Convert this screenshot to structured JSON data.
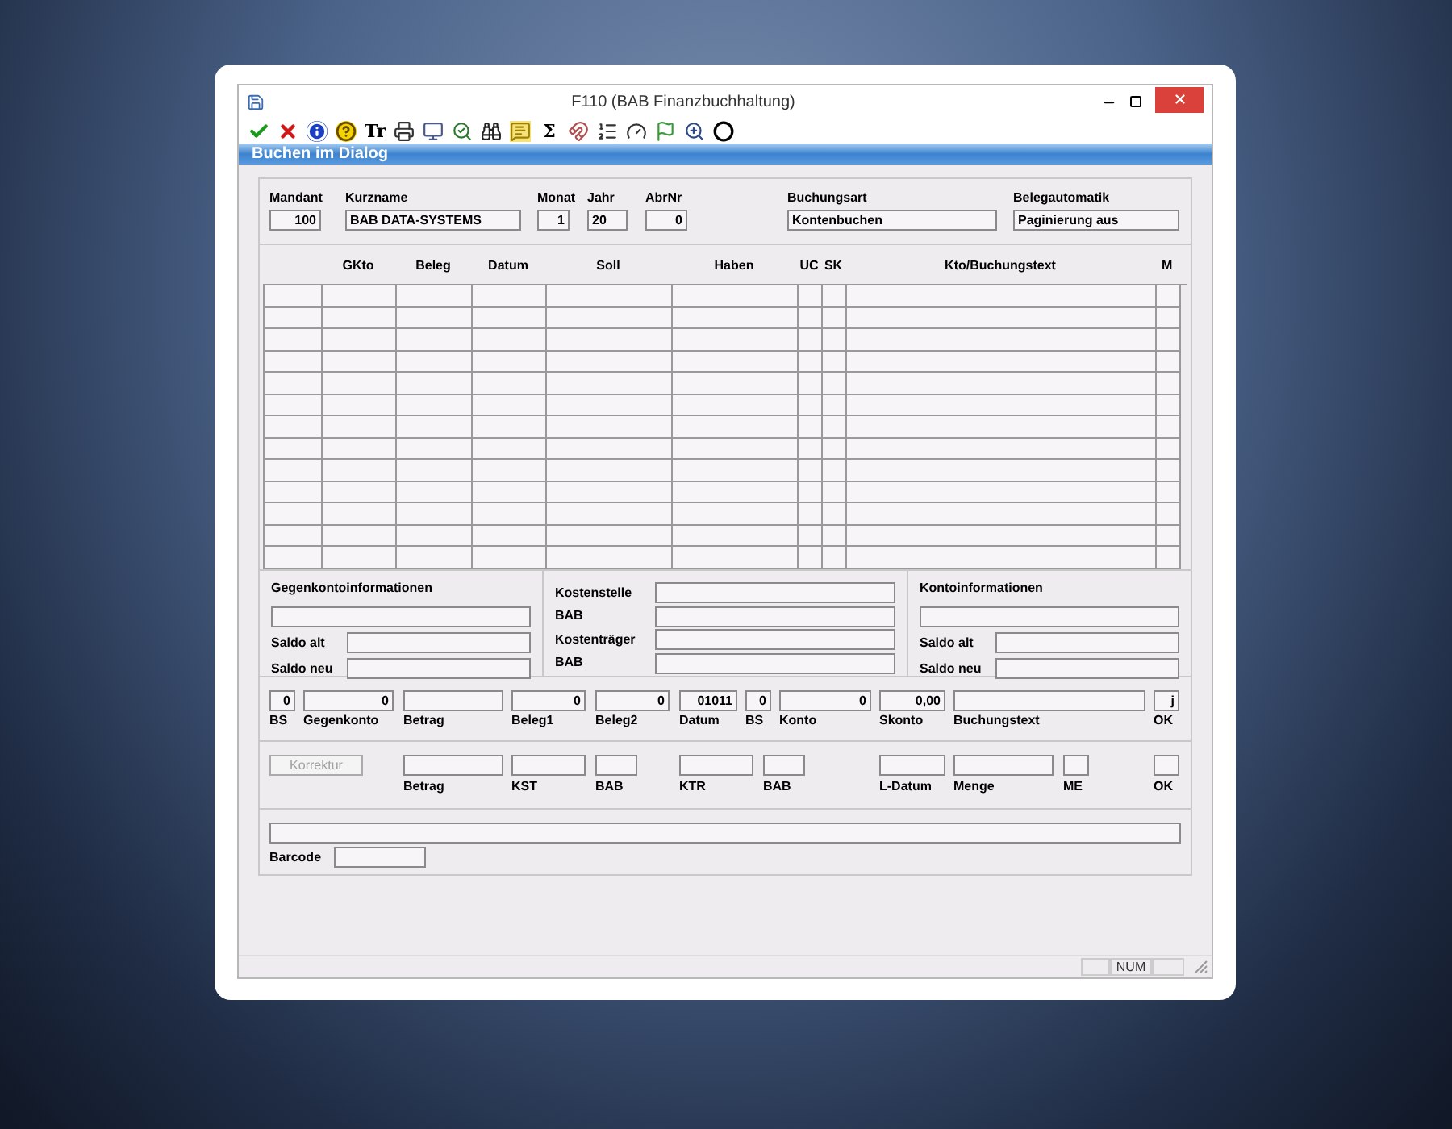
{
  "window": {
    "title": "F110 (BAB Finanzbuchhaltung)"
  },
  "toolbar_texts": [
    "Tr",
    "Σ"
  ],
  "header": {
    "title": "Buchen im Dialog"
  },
  "fields": [
    {
      "label": "Mandant",
      "value": "100",
      "kind": "number"
    },
    {
      "label": "Kurzname",
      "value": "BAB DATA-SYSTEMS",
      "kind": "text"
    },
    {
      "label": "Monat",
      "value": "1",
      "kind": "number"
    },
    {
      "label": "Jahr",
      "value": "20",
      "kind": "text"
    },
    {
      "label": "AbrNr",
      "value": "0",
      "kind": "number"
    },
    {
      "label": "Buchungsart",
      "value": "Kontenbuchen",
      "kind": "text"
    },
    {
      "label": "Belegautomatik",
      "value": "Paginierung aus",
      "kind": "text"
    }
  ],
  "table": {
    "columns": [
      "GKto",
      "Beleg",
      "Datum",
      "Soll",
      "Haben",
      "UC",
      "SK",
      "Kto/Buchungstext",
      "M"
    ]
  },
  "info": {
    "gegenkonto": {
      "title": "Gegenkontoinformationen",
      "saldo_alt": "Saldo alt",
      "saldo_neu": "Saldo neu"
    },
    "kosten": [
      "Kostenstelle",
      "BAB",
      "Kostenträger",
      "BAB"
    ],
    "konto": {
      "title": "Kontoinformationen",
      "saldo_alt": "Saldo alt",
      "saldo_neu": "Saldo neu"
    }
  },
  "entry": [
    {
      "label": "BS",
      "value": "0"
    },
    {
      "label": "Gegenkonto",
      "value": "0"
    },
    {
      "label": "Betrag"
    },
    {
      "label": "Beleg1",
      "value": "0"
    },
    {
      "label": "Beleg2",
      "value": "0"
    },
    {
      "label": "Datum",
      "value": "01011"
    },
    {
      "label": "BS",
      "value": "0"
    },
    {
      "label": "Konto",
      "value": "0"
    },
    {
      "label": "Skonto",
      "value": "0,00"
    },
    {
      "label": "Buchungstext"
    },
    {
      "label": "OK",
      "value": "j"
    }
  ],
  "korrektur": {
    "label": "Korrektur",
    "disabled": true
  },
  "details": [
    "Betrag",
    "KST",
    "BAB",
    "KTR",
    "BAB",
    "L-Datum",
    "Menge",
    "ME",
    "OK"
  ],
  "barcode": {
    "label": "Barcode"
  },
  "status_bar": {
    "num": "NUM"
  }
}
